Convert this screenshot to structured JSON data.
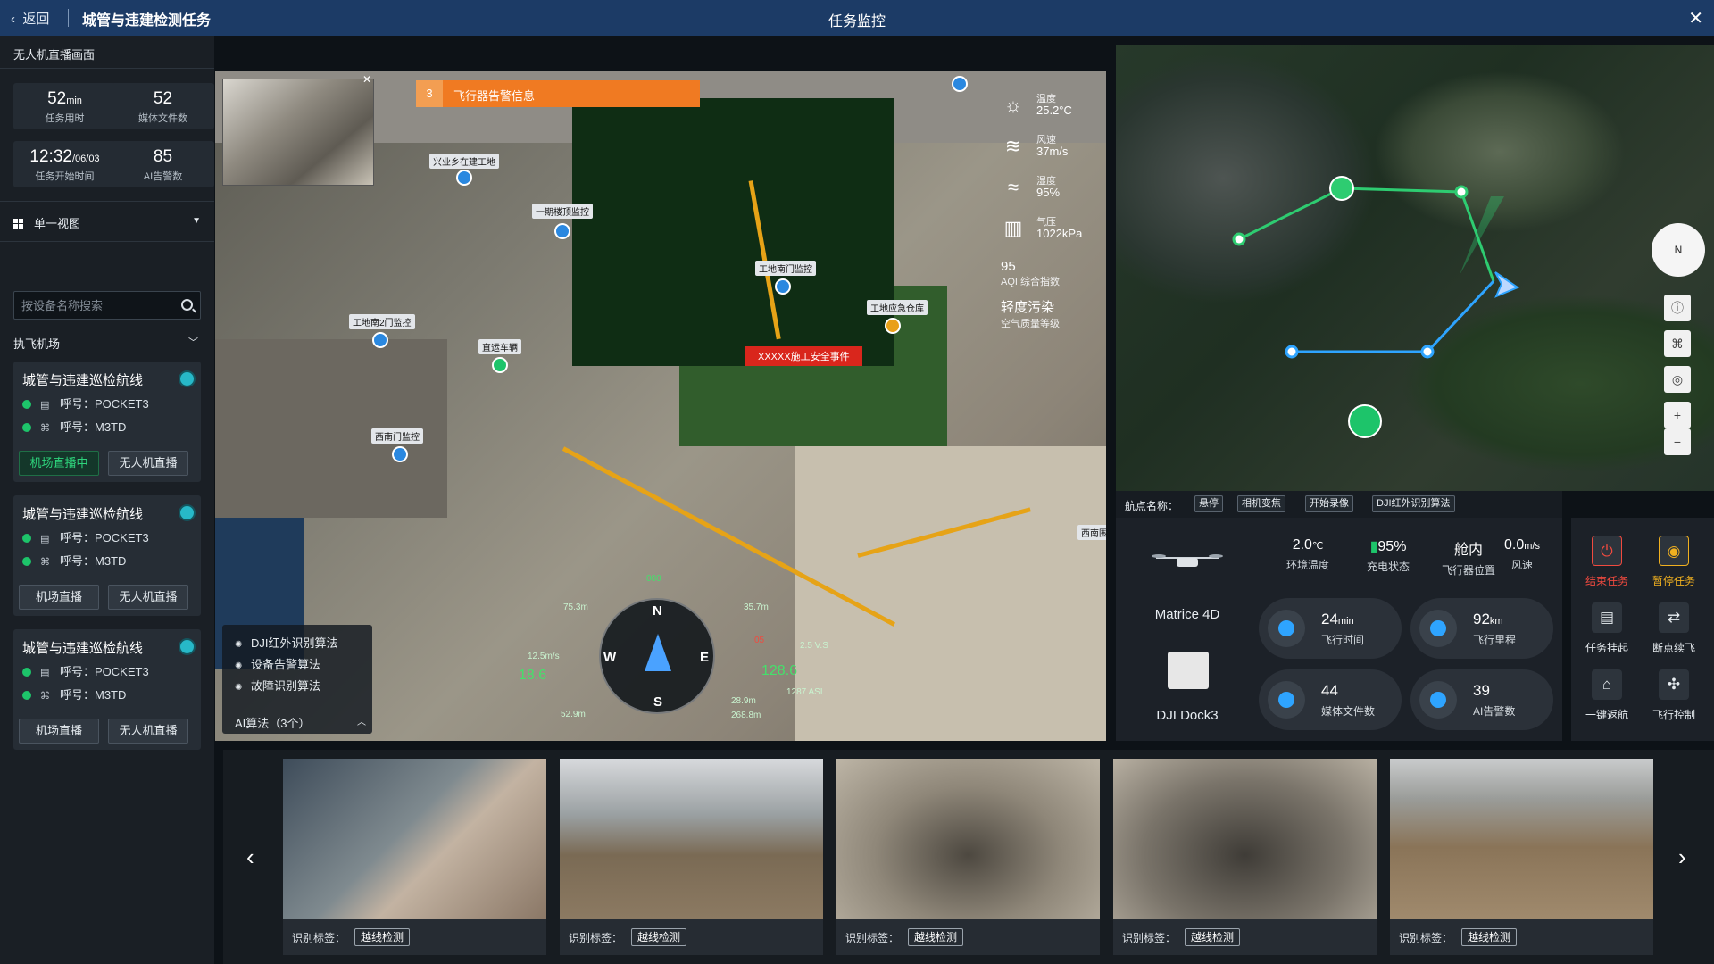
{
  "header": {
    "back_label": "返回",
    "task_title": "城管与违建检测任务",
    "center_title": "任务监控",
    "close_icon": "close-icon"
  },
  "sidebar": {
    "title": "无人机直播画面",
    "stats": [
      {
        "value": "52",
        "unit": "min",
        "label": "任务用时"
      },
      {
        "value": "52",
        "unit": "",
        "label": "媒体文件数"
      },
      {
        "value": "12:32",
        "unit": "/06/03",
        "label": "任务开始时间"
      },
      {
        "value": "85",
        "unit": "",
        "label": "AI告警数"
      }
    ],
    "view_select": "单一视图",
    "search_placeholder": "按设备名称搜索",
    "section_label": "执飞机场",
    "routes": [
      {
        "title": "城管与违建巡检航线",
        "call1": "呼号：POCKET3",
        "call2": "呼号：M3TD",
        "btn1": "机场直播中",
        "btn2": "无人机直播"
      },
      {
        "title": "城管与违建巡检航线",
        "call1": "呼号：POCKET3",
        "call2": "呼号：M3TD",
        "btn1": "机场直播",
        "btn2": "无人机直播"
      },
      {
        "title": "城管与违建巡检航线",
        "call1": "呼号：POCKET3",
        "call2": "呼号：M3TD",
        "btn1": "机场直播",
        "btn2": "无人机直播"
      }
    ]
  },
  "video": {
    "alert_count": "3",
    "alert_text": "飞行器告警信息",
    "weather": [
      {
        "icon": "sun-icon",
        "label": "温度",
        "value": "25.2°C"
      },
      {
        "icon": "wind-icon",
        "label": "风速",
        "value": "37m/s"
      },
      {
        "icon": "humidity-icon",
        "label": "湿度",
        "value": "95%"
      },
      {
        "icon": "pressure-icon",
        "label": "气压",
        "value": "1022kPa"
      }
    ],
    "aqi_value": "95",
    "aqi_label": "AQI 综合指数",
    "aqi_quality": "轻度污染",
    "aqi_quality_label": "空气质量等级",
    "tags": [
      "兴业乡在建工地",
      "一期楼顶监控",
      "工地南门监控",
      "工地南2门监控",
      "工地应急仓库",
      "西南门监控",
      "直运车辆",
      "西南围"
    ],
    "event_tag": "XXXXX施工安全事件",
    "algorithms": [
      "DJI红外识别算法",
      "设备告警算法",
      "故障识别算法"
    ],
    "algo_count": "AI算法（3个）",
    "compass": {
      "n": "N",
      "s": "S",
      "e": "E",
      "w": "W"
    },
    "hud": {
      "heading": "000",
      "alt1": "75.3m",
      "alt2": "35.7m",
      "speed": "12.5m/s",
      "speed_big": "18.6",
      "alt_big": "128.6",
      "vs": "2.5 V.S",
      "asl": "1287 ASL",
      "lowalt": "52.9m",
      "d1": "28.9m",
      "d2": "268.8m",
      "num": "05"
    }
  },
  "map": {
    "compass_label": "N"
  },
  "waypoint_bar": {
    "label": "航点名称：",
    "actions": [
      "悬停",
      "相机变焦",
      "开始录像",
      "DJI红外识别算法"
    ]
  },
  "device": {
    "drone_name": "Matrice 4D",
    "dock_name": "DJI Dock3",
    "stats": [
      {
        "value": "2.0",
        "unit": "℃",
        "label": "环境温度"
      },
      {
        "value": "95%",
        "unit": "",
        "label": "充电状态"
      },
      {
        "value": "舱内",
        "unit": "",
        "label": "飞行器位置"
      },
      {
        "value": "0.0",
        "unit": "m/s",
        "label": "风速"
      }
    ],
    "pills": [
      {
        "value": "24",
        "unit": "min",
        "label": "飞行时间",
        "icon": "clock-icon"
      },
      {
        "value": "92",
        "unit": "km",
        "label": "飞行里程",
        "icon": "gauge-icon"
      },
      {
        "value": "44",
        "unit": "",
        "label": "媒体文件数",
        "icon": "image-icon"
      },
      {
        "value": "39",
        "unit": "",
        "label": "AI告警数",
        "icon": "alarm-icon"
      }
    ]
  },
  "actions": [
    {
      "label": "结束任务",
      "icon": "power-icon",
      "color": "#f04a3f"
    },
    {
      "label": "暂停任务",
      "icon": "pause-icon",
      "color": "#f0b020"
    },
    {
      "label": "任务挂起",
      "icon": "suspend-icon",
      "color": "#e6ebef"
    },
    {
      "label": "断点续飞",
      "icon": "resume-icon",
      "color": "#e6ebef"
    },
    {
      "label": "一键返航",
      "icon": "return-home-icon",
      "color": "#e6ebef"
    },
    {
      "label": "飞行控制",
      "icon": "flight-control-icon",
      "color": "#e6ebef"
    }
  ],
  "thumbnails": [
    {
      "label": "识别标签：",
      "tag": "越线检测"
    },
    {
      "label": "识别标签：",
      "tag": "越线检测"
    },
    {
      "label": "识别标签：",
      "tag": "越线检测"
    },
    {
      "label": "识别标签：",
      "tag": "越线检测"
    },
    {
      "label": "识别标签：",
      "tag": "越线检测"
    }
  ],
  "colors": {
    "header_bg": "#1c3b66",
    "accent_green": "#2ed47c",
    "alert_orange": "#f07a22",
    "event_red": "#d9261c",
    "route_green": "#2ecc71",
    "route_blue": "#2ea4ff"
  }
}
